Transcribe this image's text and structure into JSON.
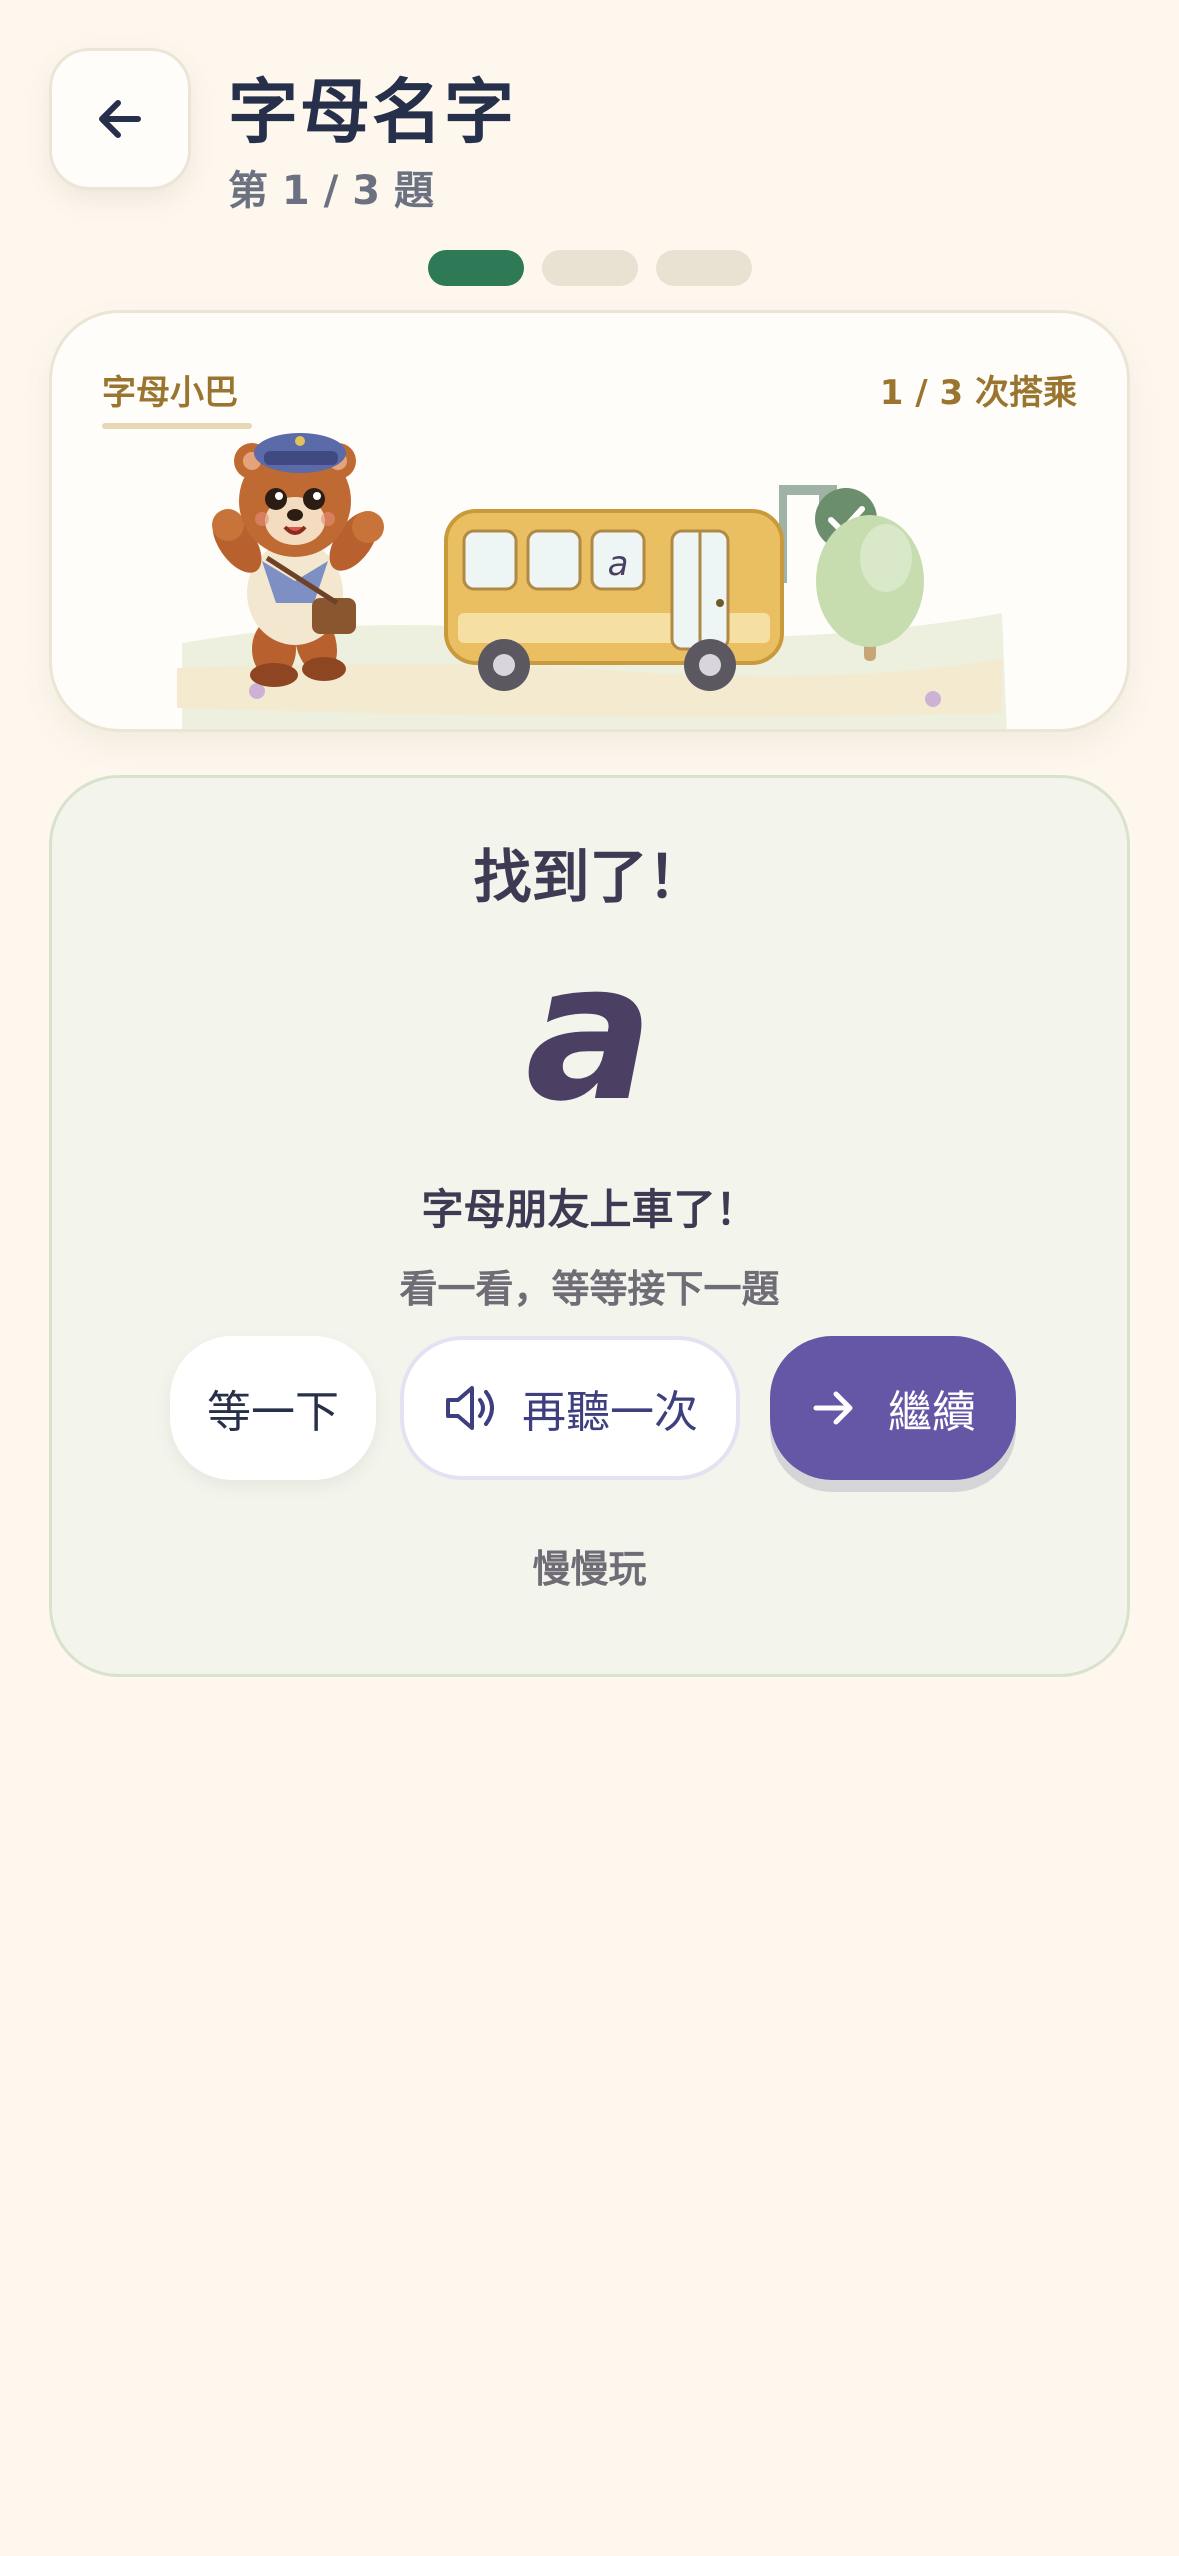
{
  "header": {
    "title": "字母名字",
    "subtitle": "第 1 / 3 題",
    "back_icon": "arrow-left-icon"
  },
  "progress": {
    "total": 3,
    "current": 1
  },
  "scene": {
    "label": "字母小巴",
    "count": "1 / 3 次搭乘",
    "bus_letter": "a",
    "icons": [
      "bear-conductor",
      "bus-icon",
      "flag-icon",
      "check-icon",
      "tree-icon"
    ]
  },
  "result": {
    "heading": "找到了！",
    "letter": "a",
    "message": "字母朋友上車了！",
    "hint": "看一看，等等接下一題"
  },
  "buttons": {
    "wait": "等一下",
    "replay": "再聽一次",
    "replay_icon": "speaker-icon",
    "continue": "繼續",
    "continue_icon": "arrow-right-icon"
  },
  "footer": {
    "slow_link": "慢慢玩"
  },
  "colors": {
    "background": "#fdf7ee",
    "accent_green": "#2e7a57",
    "accent_purple": "#6656a6",
    "label_gold": "#9a7530",
    "bus_yellow": "#e9bf62"
  }
}
